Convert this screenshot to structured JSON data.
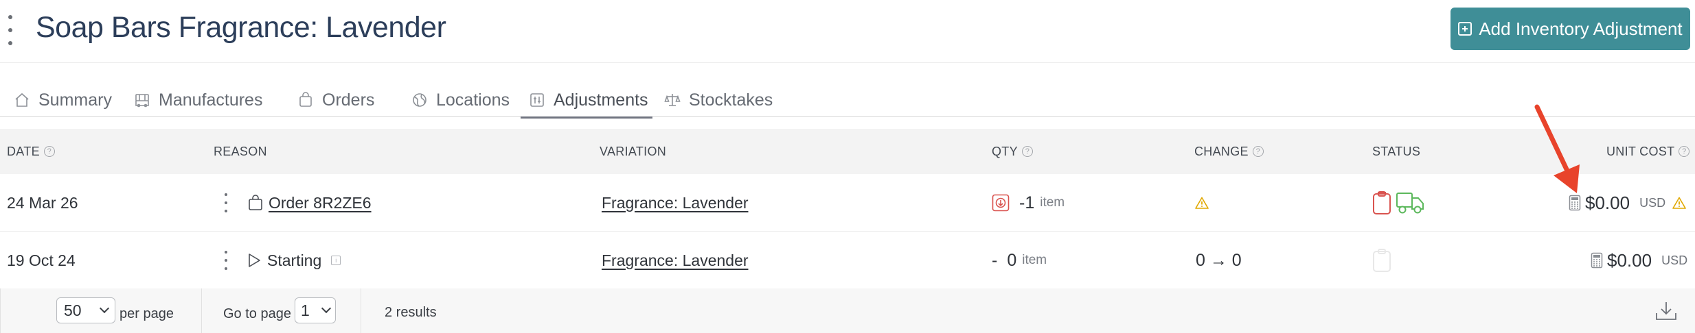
{
  "header": {
    "title": "Soap Bars Fragrance: Lavender",
    "add_button_label": "Add Inventory Adjustment"
  },
  "tabs": [
    {
      "label": "Summary",
      "icon": "home-icon"
    },
    {
      "label": "Manufactures",
      "icon": "factory-icon"
    },
    {
      "label": "Orders",
      "icon": "shopping-bag-icon"
    },
    {
      "label": "Locations",
      "icon": "globe-icon"
    },
    {
      "label": "Adjustments",
      "icon": "adjustments-icon",
      "active": true
    },
    {
      "label": "Stocktakes",
      "icon": "scale-icon"
    }
  ],
  "table": {
    "columns": {
      "date": "DATE",
      "reason": "REASON",
      "variation": "VARIATION",
      "qty": "QTY",
      "change": "CHANGE",
      "status": "STATUS",
      "unit_cost": "UNIT COST"
    },
    "rows": [
      {
        "date": "24 Mar 26",
        "reason": "Order 8R2ZE6",
        "variation": "Fragrance: Lavender",
        "qty_sign": "",
        "qty": "-1",
        "qty_unit": "item",
        "change": "",
        "cost": "$0.00",
        "currency": "USD"
      },
      {
        "date": "19 Oct 24",
        "reason": "Starting",
        "variation": "Fragrance: Lavender",
        "qty_sign": "-",
        "qty": "0",
        "qty_unit": "item",
        "change": "0 → 0",
        "cost": "$0.00",
        "currency": "USD"
      }
    ]
  },
  "footer": {
    "per_page_value": "50",
    "per_page_label": "per page",
    "goto_label": "Go to page",
    "page_value": "1",
    "results": "2 results"
  },
  "colors": {
    "accent": "#3f8e97",
    "warning": "#e0a800",
    "danger": "#d9534f",
    "success": "#5cb85c",
    "arrow": "#e8432b"
  }
}
